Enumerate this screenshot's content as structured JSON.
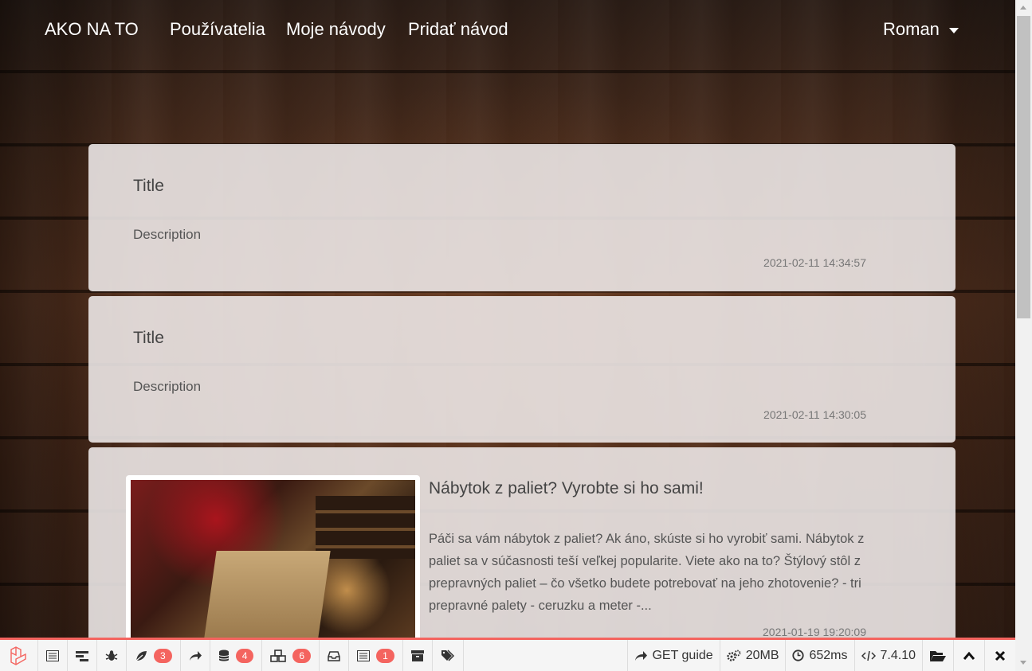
{
  "navbar": {
    "brand": "AKO NA TO",
    "links": [
      "Používatelia",
      "Moje návody",
      "Pridať návod"
    ],
    "user": "Roman"
  },
  "cards": [
    {
      "title": "Title",
      "description": "Description",
      "date": "2021-02-11 14:34:57"
    },
    {
      "title": "Title",
      "description": "Description",
      "date": "2021-02-11 14:30:05"
    }
  ],
  "featured": {
    "title": "Nábytok z paliet? Vyrobte si ho sami!",
    "text": "Páči sa vám nábytok z paliet? Ak áno, skúste si ho vyrobiť sami. Nábytok z paliet sa v súčasnosti teší veľkej popularite. Viete ako na to? Štýlový stôl z prepravných paliet – čo všetko budete potrebovať na jeho zhotovenie? - tri prepravné palety - ceruzku a meter -...",
    "date": "2021-01-19 19:20:09",
    "image_alt": "pallet-desk-photo"
  },
  "debugbar": {
    "accent": "#f4645f",
    "tabs": [
      {
        "icon": "messages-icon",
        "badge": ""
      },
      {
        "icon": "timeline-icon",
        "badge": ""
      },
      {
        "icon": "bug-icon",
        "badge": ""
      },
      {
        "icon": "leaf-icon",
        "badge": "3"
      },
      {
        "icon": "share-icon",
        "badge": ""
      },
      {
        "icon": "database-icon",
        "badge": "4"
      },
      {
        "icon": "cubes-icon",
        "badge": "6"
      },
      {
        "icon": "inbox-icon",
        "badge": ""
      },
      {
        "icon": "list-icon",
        "badge": "1"
      },
      {
        "icon": "archive-icon",
        "badge": ""
      },
      {
        "icon": "tags-icon",
        "badge": ""
      }
    ],
    "route": "GET guide",
    "memory": "20MB",
    "time": "652ms",
    "php_version": "7.4.10"
  }
}
